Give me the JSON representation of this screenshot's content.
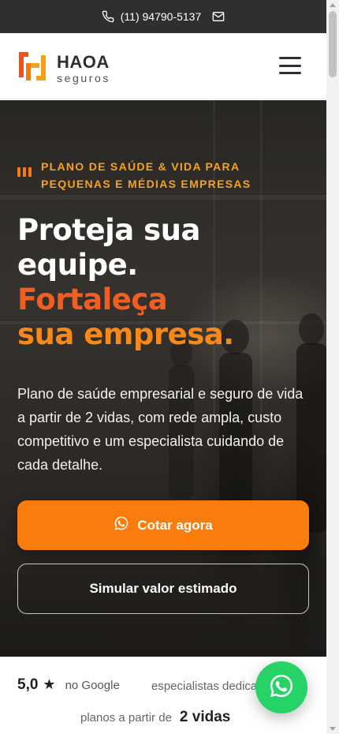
{
  "topbar": {
    "phone": "(11) 94790-5137",
    "phone_icon": "phone-icon",
    "email_icon": "mail-icon"
  },
  "header": {
    "logo_name": "HAOA",
    "logo_sub": "seguros",
    "menu_icon": "hamburger-icon"
  },
  "hero": {
    "kicker": "PLANO DE SAÚDE & VIDA PARA PEQUENAS E MÉDIAS EMPRESAS",
    "headline_line1": "Proteja sua",
    "headline_line2": "equipe.",
    "headline_line3": "Fortaleça",
    "headline_line4": "sua empresa.",
    "description": "Plano de saúde empresarial e seguro de vida a partir de 2 vidas, com rede ampla, custo competitivo e um especialista cuidando de cada detalhe.",
    "primary_cta": "Cotar agora",
    "secondary_cta": "Simular valor estimado"
  },
  "stats": {
    "rating_value": "5,0",
    "rating_star": "★",
    "rating_source": "no Google",
    "specialists_label": "especialistas dedicados",
    "plans_label": "planos a partir de",
    "plans_value": "2 vidas"
  },
  "colors": {
    "accent_orange": "#f97c0c",
    "kicker_yellow": "#f6a21b",
    "headline_red": "#f25e22",
    "whatsapp_green": "#25d366",
    "topbar_bg": "#2f2f31"
  }
}
